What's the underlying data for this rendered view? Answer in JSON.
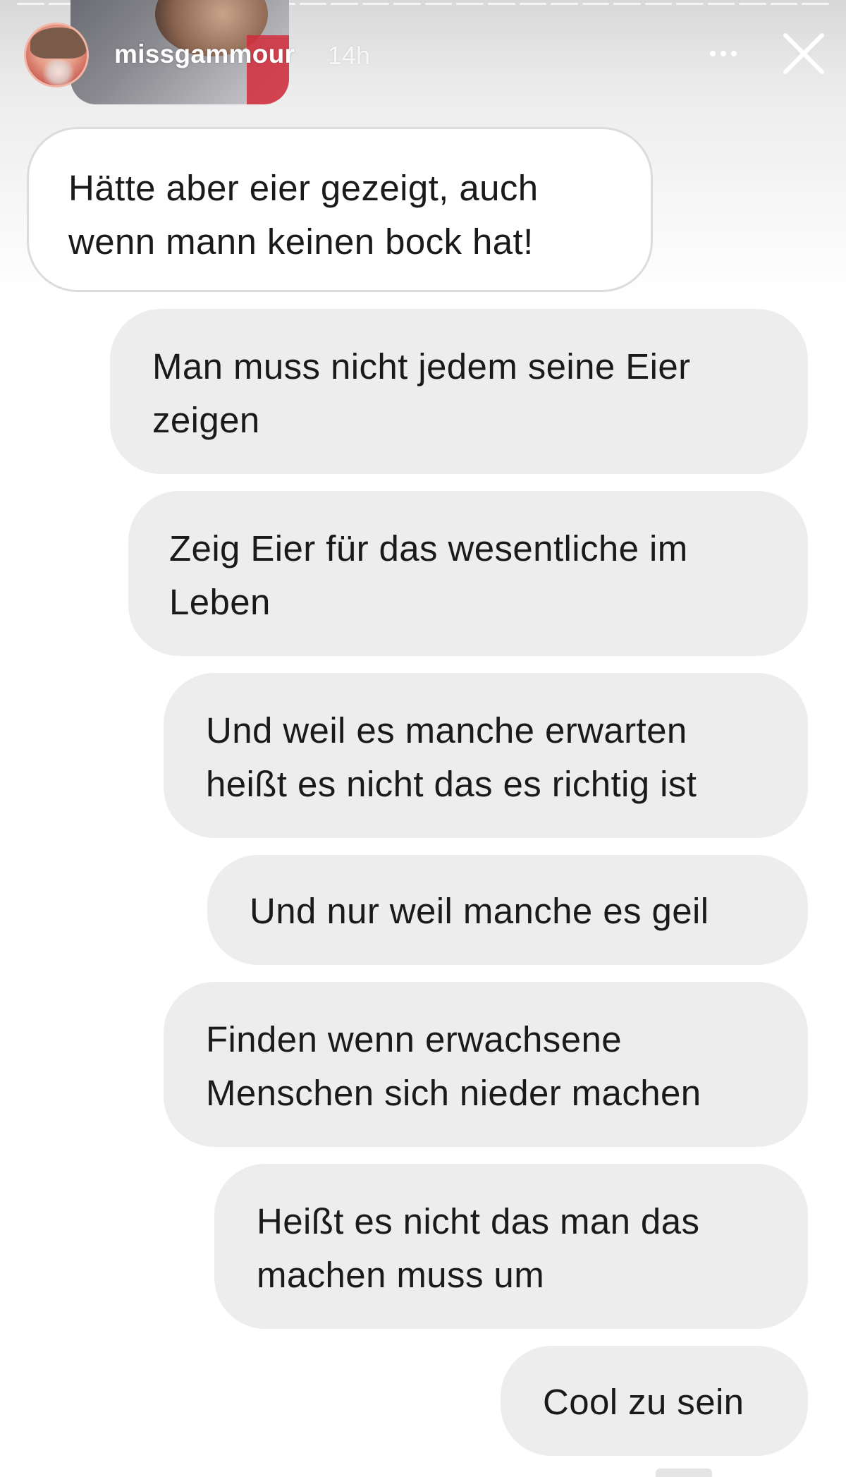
{
  "story_header": {
    "username": "missgammour",
    "time": "14h",
    "more_icon": "more-horizontal-icon",
    "close_icon": "close-x-icon"
  },
  "messages": [
    {
      "direction": "received",
      "text": "Hätte aber eier gezeigt, auch\nwenn mann keinen bock hat!"
    },
    {
      "direction": "sent",
      "text": "Man muss nicht jedem seine Eier\nzeigen"
    },
    {
      "direction": "sent",
      "text": "Zeig Eier für das wesentliche im\nLeben"
    },
    {
      "direction": "sent",
      "text": "Und weil es manche erwarten\nheißt es nicht das es richtig ist"
    },
    {
      "direction": "sent",
      "text": "Und nur weil manche es geil"
    },
    {
      "direction": "sent",
      "text": "Finden wenn erwachsene\nMenschen sich nieder machen"
    },
    {
      "direction": "sent",
      "text": "Heißt es nicht das man das\nmachen muss um"
    },
    {
      "direction": "sent",
      "text": "Cool zu sein"
    }
  ],
  "colors": {
    "received_bubble": "#ffffff",
    "received_border": "#dcdcdc",
    "sent_bubble": "#ededed",
    "text": "#1a1a1a",
    "header_text": "#ffffff"
  }
}
